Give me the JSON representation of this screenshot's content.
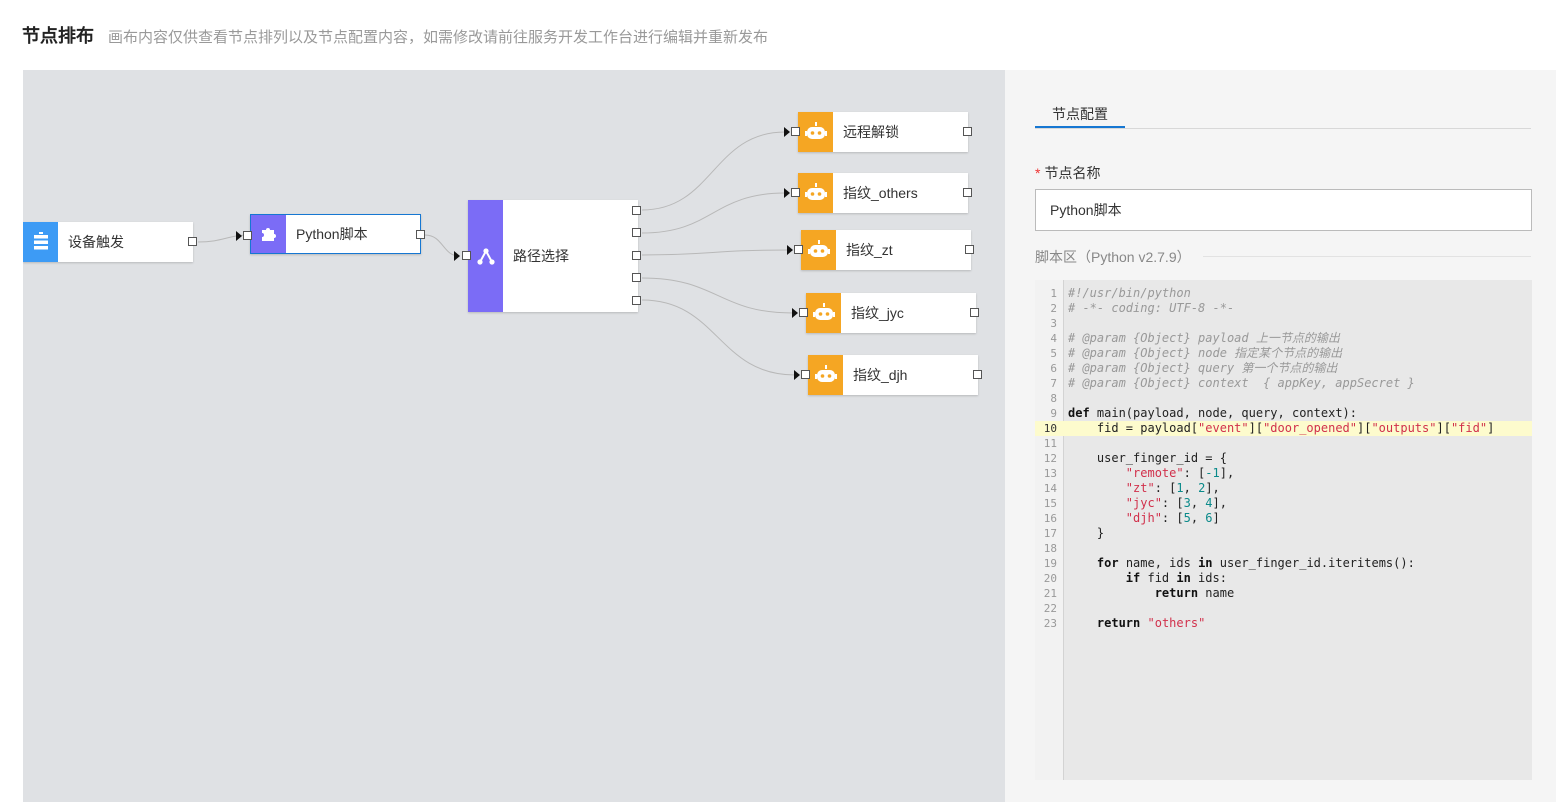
{
  "header": {
    "title": "节点排布",
    "description": "画布内容仅供查看节点排列以及节点配置内容，如需修改请前往服务开发工作台进行编辑并重新发布"
  },
  "canvas": {
    "nodes": [
      {
        "id": "trigger",
        "label": "设备触发",
        "icon": "device-trigger-icon",
        "color": "#3d9bf5"
      },
      {
        "id": "python",
        "label": "Python脚本",
        "icon": "puzzle-icon",
        "color": "#7b6cf6"
      },
      {
        "id": "router",
        "label": "路径选择",
        "icon": "branch-icon",
        "color": "#7b6cf6"
      },
      {
        "id": "remote",
        "label": "远程解锁",
        "icon": "robot-icon",
        "color": "#f5a623"
      },
      {
        "id": "others",
        "label": "指纹_others",
        "icon": "robot-icon",
        "color": "#f5a623"
      },
      {
        "id": "zt",
        "label": "指纹_zt",
        "icon": "robot-icon",
        "color": "#f5a623"
      },
      {
        "id": "jyc",
        "label": "指纹_jyc",
        "icon": "robot-icon",
        "color": "#f5a623"
      },
      {
        "id": "djh",
        "label": "指纹_djh",
        "icon": "robot-icon",
        "color": "#f5a623"
      }
    ]
  },
  "panel": {
    "tab": "节点配置",
    "name_label": "节点名称",
    "name_required": "*",
    "name_value": "Python脚本",
    "script_label": "脚本区（Python v2.7.9）",
    "active_line": 10,
    "code": [
      "#!/usr/bin/python",
      "# -*- coding: UTF-8 -*-",
      "",
      "# @param {Object} payload 上一节点的输出",
      "# @param {Object} node 指定某个节点的输出",
      "# @param {Object} query 第一个节点的输出",
      "# @param {Object} context  { appKey, appSecret }",
      "",
      "def main(payload, node, query, context):",
      "    fid = payload[\"event\"][\"door_opened\"][\"outputs\"][\"fid\"]",
      "",
      "    user_finger_id = {",
      "        \"remote\": [-1],",
      "        \"zt\": [1, 2],",
      "        \"jyc\": [3, 4],",
      "        \"djh\": [5, 6]",
      "    }",
      "",
      "    for name, ids in user_finger_id.iteritems():",
      "        if fid in ids:",
      "            return name",
      "",
      "    return \"others\""
    ]
  }
}
